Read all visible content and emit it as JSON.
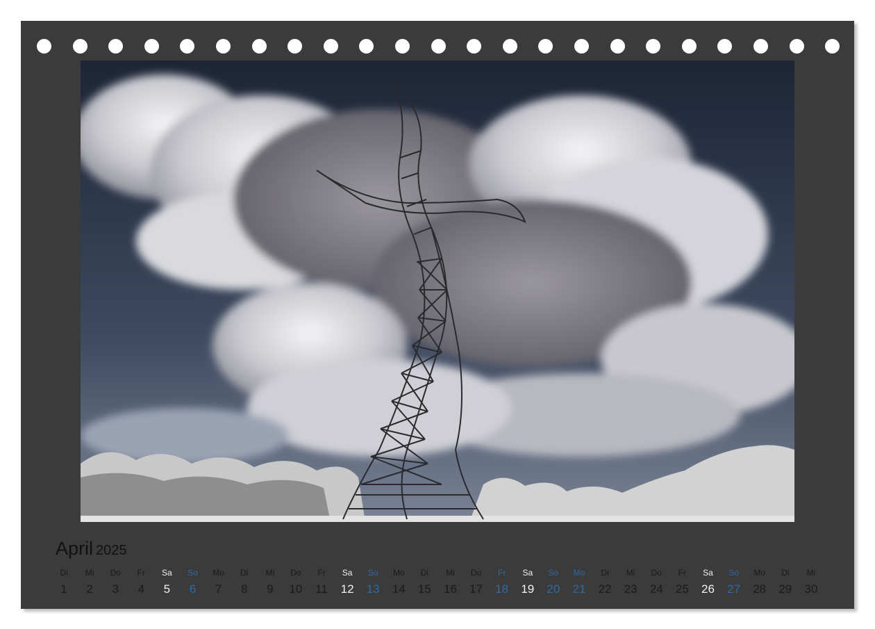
{
  "calendar": {
    "month": "April",
    "year": "2025",
    "colors": {
      "frame": "#3b3b3b",
      "weekday_text": "#1a1a1a",
      "saturday_text": "#f2f2f2",
      "holiday_text": "#2f6aa6"
    },
    "days": [
      {
        "dow": "Di",
        "num": "1",
        "kind": "weekday"
      },
      {
        "dow": "Mi",
        "num": "2",
        "kind": "weekday"
      },
      {
        "dow": "Do",
        "num": "3",
        "kind": "weekday"
      },
      {
        "dow": "Fr",
        "num": "4",
        "kind": "weekday"
      },
      {
        "dow": "Sa",
        "num": "5",
        "kind": "saturday"
      },
      {
        "dow": "So",
        "num": "6",
        "kind": "holiday"
      },
      {
        "dow": "Mo",
        "num": "7",
        "kind": "weekday"
      },
      {
        "dow": "Di",
        "num": "8",
        "kind": "weekday"
      },
      {
        "dow": "Mi",
        "num": "9",
        "kind": "weekday"
      },
      {
        "dow": "Do",
        "num": "10",
        "kind": "weekday"
      },
      {
        "dow": "Fr",
        "num": "11",
        "kind": "weekday"
      },
      {
        "dow": "Sa",
        "num": "12",
        "kind": "saturday"
      },
      {
        "dow": "So",
        "num": "13",
        "kind": "holiday"
      },
      {
        "dow": "Mo",
        "num": "14",
        "kind": "weekday"
      },
      {
        "dow": "Di",
        "num": "15",
        "kind": "weekday"
      },
      {
        "dow": "Mi",
        "num": "16",
        "kind": "weekday"
      },
      {
        "dow": "Do",
        "num": "17",
        "kind": "weekday"
      },
      {
        "dow": "Fr",
        "num": "18",
        "kind": "holiday"
      },
      {
        "dow": "Sa",
        "num": "19",
        "kind": "saturday"
      },
      {
        "dow": "So",
        "num": "20",
        "kind": "holiday"
      },
      {
        "dow": "Mo",
        "num": "21",
        "kind": "holiday"
      },
      {
        "dow": "Di",
        "num": "22",
        "kind": "weekday"
      },
      {
        "dow": "Mi",
        "num": "23",
        "kind": "weekday"
      },
      {
        "dow": "Do",
        "num": "24",
        "kind": "weekday"
      },
      {
        "dow": "Fr",
        "num": "25",
        "kind": "weekday"
      },
      {
        "dow": "Sa",
        "num": "26",
        "kind": "saturday"
      },
      {
        "dow": "So",
        "num": "27",
        "kind": "holiday"
      },
      {
        "dow": "Mo",
        "num": "28",
        "kind": "weekday"
      },
      {
        "dow": "Di",
        "num": "29",
        "kind": "weekday"
      },
      {
        "dow": "Mi",
        "num": "30",
        "kind": "weekday"
      }
    ]
  },
  "binding": {
    "hole_count": 23,
    "hole_icon": "binding-hole-icon"
  },
  "photo": {
    "subject_icon": "dancing-pylon-sculpture"
  }
}
